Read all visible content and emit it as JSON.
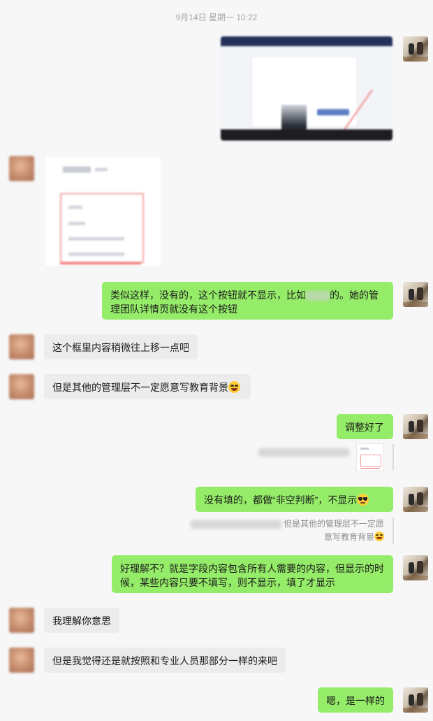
{
  "timestamp": "9月14日 星期一 10:22",
  "messages": {
    "m1_text_a": "类似这样，没有的，这个按钮就不显示，比如",
    "m1_text_b": "的。她的管理团队详情页就没有这个按钮",
    "m2": "这个框里内容稍微往上移一点吧",
    "m3": "但是其他的管理层不一定愿意写教育背景",
    "m4": "调整好了",
    "m5": "没有填的，都做“非空判断”，不显示",
    "m5_quote": "但是其他的管理层不一定愿意写教育背景",
    "m6": "好理解不？就是字段内容包含所有人需要的内容，但显示的时候，某些内容只要不填写，则不显示，填了才显示",
    "m7": "我理解你意思",
    "m8": "但是我觉得还是就按照和专业人员那部分一样的来吧",
    "m9": "嗯，是一样的"
  },
  "emojis": {
    "laugh": "grin-sweat-emoji",
    "cool": "sunglasses-emoji"
  },
  "colors": {
    "background": "#f7f7f8",
    "sent_bubble": "#95ec69",
    "received_bubble": "#ececec"
  }
}
